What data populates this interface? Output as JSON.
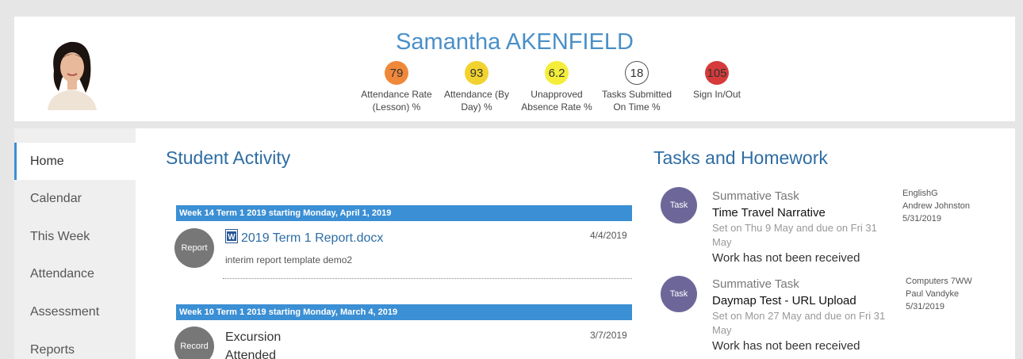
{
  "student": {
    "name": "Samantha AKENFIELD",
    "metrics": [
      {
        "value": "79",
        "label1": "Attendance Rate",
        "label2": "(Lesson) %",
        "color": "#f0883a"
      },
      {
        "value": "93",
        "label1": "Attendance (By",
        "label2": "Day) %",
        "color": "#f2d22e"
      },
      {
        "value": "6.2",
        "label1": "Unapproved",
        "label2": "Absence Rate %",
        "color": "#f4ee3a"
      },
      {
        "value": "18",
        "label1": "Tasks Submitted",
        "label2": "On Time %",
        "color": "#ffffff"
      },
      {
        "value": "105",
        "label1": "Sign In/Out",
        "label2": "",
        "color": "#d63a3a"
      }
    ]
  },
  "sidebar": {
    "items": [
      {
        "label": "Home",
        "active": true
      },
      {
        "label": "Calendar"
      },
      {
        "label": "This Week"
      },
      {
        "label": "Attendance"
      },
      {
        "label": "Assessment"
      },
      {
        "label": "Reports"
      }
    ]
  },
  "activity": {
    "title": "Student Activity",
    "weeks": [
      {
        "heading": "Week 14 Term 1 2019 starting Monday, April 1, 2019",
        "item": {
          "badge": "Report",
          "title": "2019 Term 1 Report.docx",
          "date": "4/4/2019",
          "subtitle": "interim report template demo2",
          "icon": "word-doc-icon"
        }
      },
      {
        "heading": "Week 10 Term 1 2019 starting Monday, March 4, 2019",
        "item": {
          "badge": "Record",
          "title": "Excursion",
          "date": "3/7/2019",
          "subtitle": "Attended"
        }
      }
    ]
  },
  "tasks": {
    "title": "Tasks and Homework",
    "items": [
      {
        "badge": "Task",
        "type": "Summative Task",
        "title": "Time Travel Narrative",
        "due": "Set on Thu 9 May and due on Fri 31 May",
        "status": "Work has not been received",
        "subject": "EnglishG",
        "teacher": "Andrew Johnston",
        "date": "5/31/2019"
      },
      {
        "badge": "Task",
        "type": "Summative Task",
        "title": "Daymap Test - URL Upload",
        "due": "Set on Mon 27 May and due on Fri 31 May",
        "status": "Work has not been received",
        "subject": "Computers 7WW",
        "teacher": "Paul Vandyke",
        "date": "5/31/2019"
      }
    ]
  }
}
